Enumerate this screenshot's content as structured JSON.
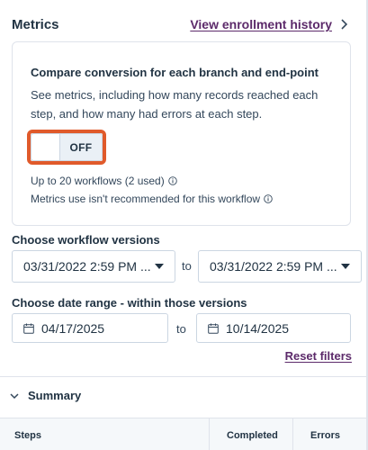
{
  "header": {
    "title": "Metrics",
    "history_link": "View enrollment history"
  },
  "card": {
    "title": "Compare conversion for each branch and end-point",
    "description": "See metrics, including how many records reached each step, and how many had errors at each step.",
    "toggle_label": "OFF",
    "toggle_state": "off",
    "info_1": "Up to 20 workflows (2 used)",
    "info_2": "Metrics use isn't recommended for this workflow"
  },
  "versions": {
    "label": "Choose workflow versions",
    "from_value": "03/31/2022 2:59 PM ...",
    "to_text": "to",
    "to_value": "03/31/2022 2:59 PM ..."
  },
  "date_range": {
    "label": "Choose date range - within those versions",
    "start_value": "04/17/2025",
    "to_text": "to",
    "end_value": "10/14/2025",
    "reset_label": "Reset filters"
  },
  "summary": {
    "label": "Summary"
  },
  "table": {
    "columns": [
      "Steps",
      "Completed",
      "Errors"
    ]
  },
  "colors": {
    "link": "#5c2a6a",
    "highlight": "#e05a2b",
    "text": "#213343"
  }
}
